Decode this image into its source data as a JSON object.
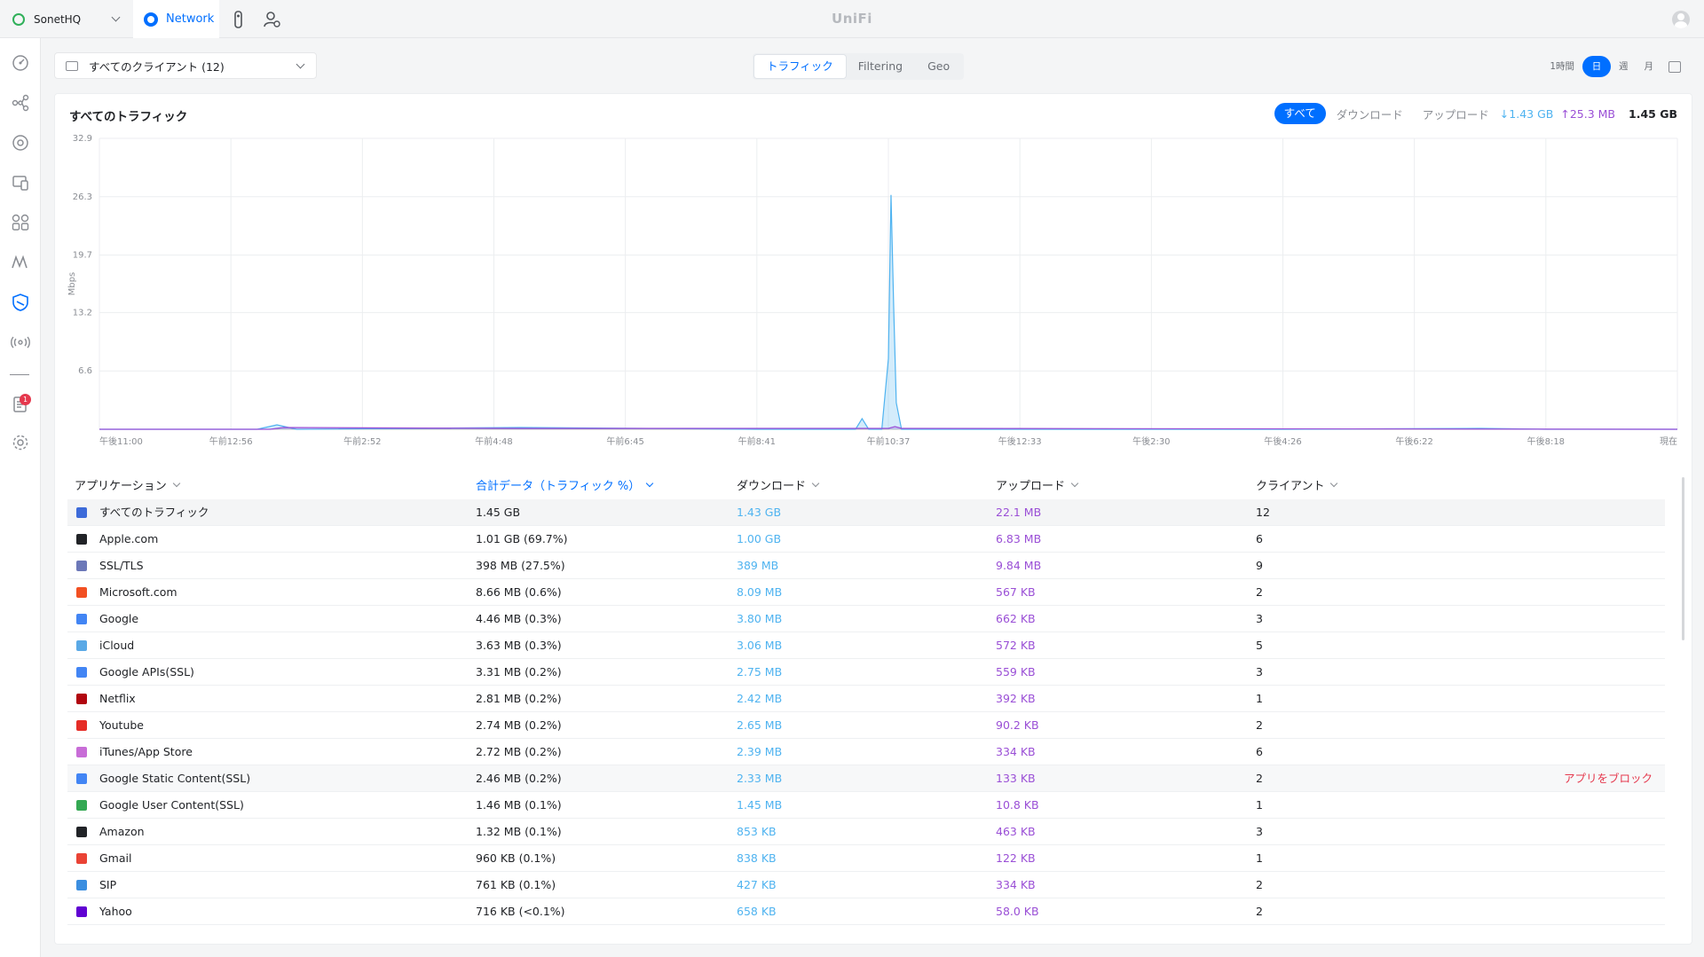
{
  "topbar": {
    "site_name": "SonetHQ",
    "app_tab": "Network",
    "brand": "UniFi"
  },
  "sidebar": {
    "notification_count": "1",
    "items": [
      "dashboard-icon",
      "topology-icon",
      "devices-icon",
      "clients-icon",
      "statistics-icon",
      "insights-icon",
      "security-icon",
      "wifi-icon",
      "alerts-icon",
      "settings-icon"
    ]
  },
  "filter": {
    "client_selector": "すべてのクライアント (12)"
  },
  "view_tabs": [
    "トラフィック",
    "Filtering",
    "Geo"
  ],
  "time_range": [
    "1時間",
    "日",
    "週",
    "月"
  ],
  "card": {
    "title": "すべてのトラフィック",
    "filter_options": [
      "すべて",
      "ダウンロード",
      "アップロード"
    ],
    "download_total": "1.43 GB",
    "upload_total": "25.3 MB",
    "grand_total": "1.45 GB"
  },
  "chart_data": {
    "type": "area",
    "ylabel": "Mbps",
    "ylim": [
      0,
      32.9
    ],
    "yticks": [
      6.6,
      13.2,
      19.7,
      26.3,
      32.9
    ],
    "xticks": [
      "午後11:00",
      "午前12:56",
      "午前2:52",
      "午前4:48",
      "午前6:45",
      "午前8:41",
      "午前10:37",
      "午後12:33",
      "午後2:30",
      "午後4:26",
      "午後6:22",
      "午後8:18",
      "現在"
    ],
    "grid": true,
    "series": [
      {
        "name": "ダウンロード",
        "color": "#4fb3f0",
        "x": [
          0,
          0.5,
          1.2,
          1.35,
          1.5,
          3.2,
          5,
          5.75,
          5.8,
          5.85,
          5.95,
          6,
          6.02,
          6.04,
          6.06,
          6.1,
          6.2,
          7,
          9,
          10.5,
          11,
          12
        ],
        "values": [
          0,
          0,
          0,
          0.5,
          0,
          0.2,
          0,
          0,
          1.2,
          0,
          0,
          8,
          26.5,
          14,
          3,
          0,
          0,
          0,
          0,
          0.1,
          0,
          0
        ]
      },
      {
        "name": "アップロード",
        "color": "#9a4fd6",
        "x": [
          0,
          1.3,
          1.4,
          3.2,
          6.0,
          6.05,
          6.1,
          12
        ],
        "values": [
          0,
          0,
          0.2,
          0.1,
          0.1,
          0.3,
          0.1,
          0
        ]
      }
    ]
  },
  "table": {
    "headers": {
      "app": "アプリケーション",
      "total": "合計データ（トラフィック %）",
      "download": "ダウンロード",
      "upload": "アップロード",
      "clients": "クライアント"
    },
    "block_label": "アプリをブロック",
    "rows": [
      {
        "icon": "all-traffic-icon",
        "color": "#3d6bd9",
        "name": "すべてのトラフィック",
        "total": "1.45 GB",
        "download": "1.43 GB",
        "upload": "22.1 MB",
        "clients": "12"
      },
      {
        "icon": "apple-icon",
        "color": "#212327",
        "name": "Apple.com",
        "total": "1.01 GB (69.7%)",
        "download": "1.00 GB",
        "upload": "6.83 MB",
        "clients": "6"
      },
      {
        "icon": "ssl-shield-icon",
        "color": "#6c78b8",
        "name": "SSL/TLS",
        "total": "398 MB (27.5%)",
        "download": "389 MB",
        "upload": "9.84 MB",
        "clients": "9"
      },
      {
        "icon": "microsoft-icon",
        "color": "#f25022",
        "name": "Microsoft.com",
        "total": "8.66 MB (0.6%)",
        "download": "8.09 MB",
        "upload": "567 KB",
        "clients": "2"
      },
      {
        "icon": "google-icon",
        "color": "#4285f4",
        "name": "Google",
        "total": "4.46 MB (0.3%)",
        "download": "3.80 MB",
        "upload": "662 KB",
        "clients": "3"
      },
      {
        "icon": "icloud-icon",
        "color": "#5aa9e6",
        "name": "iCloud",
        "total": "3.63 MB (0.3%)",
        "download": "3.06 MB",
        "upload": "572 KB",
        "clients": "5"
      },
      {
        "icon": "google-apis-icon",
        "color": "#4285f4",
        "name": "Google APIs(SSL)",
        "total": "3.31 MB (0.2%)",
        "download": "2.75 MB",
        "upload": "559 KB",
        "clients": "3"
      },
      {
        "icon": "netflix-icon",
        "color": "#b1060f",
        "name": "Netflix",
        "total": "2.81 MB (0.2%)",
        "download": "2.42 MB",
        "upload": "392 KB",
        "clients": "1"
      },
      {
        "icon": "youtube-icon",
        "color": "#e52d27",
        "name": "Youtube",
        "total": "2.74 MB (0.2%)",
        "download": "2.65 MB",
        "upload": "90.2 KB",
        "clients": "2"
      },
      {
        "icon": "itunes-icon",
        "color": "#c86dd7",
        "name": "iTunes/App Store",
        "total": "2.72 MB (0.2%)",
        "download": "2.39 MB",
        "upload": "334 KB",
        "clients": "6"
      },
      {
        "icon": "google-static-icon",
        "color": "#4285f4",
        "name": "Google Static Content(SSL)",
        "total": "2.46 MB (0.2%)",
        "download": "2.33 MB",
        "upload": "133 KB",
        "clients": "2",
        "hover": true
      },
      {
        "icon": "google-user-content-icon",
        "color": "#34a853",
        "name": "Google User Content(SSL)",
        "total": "1.46 MB (0.1%)",
        "download": "1.45 MB",
        "upload": "10.8 KB",
        "clients": "1"
      },
      {
        "icon": "amazon-icon",
        "color": "#212327",
        "name": "Amazon",
        "total": "1.32 MB (0.1%)",
        "download": "853 KB",
        "upload": "463 KB",
        "clients": "3"
      },
      {
        "icon": "gmail-icon",
        "color": "#ea4335",
        "name": "Gmail",
        "total": "960 KB (0.1%)",
        "download": "838 KB",
        "upload": "122 KB",
        "clients": "1"
      },
      {
        "icon": "sip-icon",
        "color": "#3b8ee0",
        "name": "SIP",
        "total": "761 KB (0.1%)",
        "download": "427 KB",
        "upload": "334 KB",
        "clients": "2"
      },
      {
        "icon": "yahoo-icon",
        "color": "#6001d2",
        "name": "Yahoo",
        "total": "716 KB (<0.1%)",
        "download": "658 KB",
        "upload": "58.0 KB",
        "clients": "2"
      }
    ]
  }
}
